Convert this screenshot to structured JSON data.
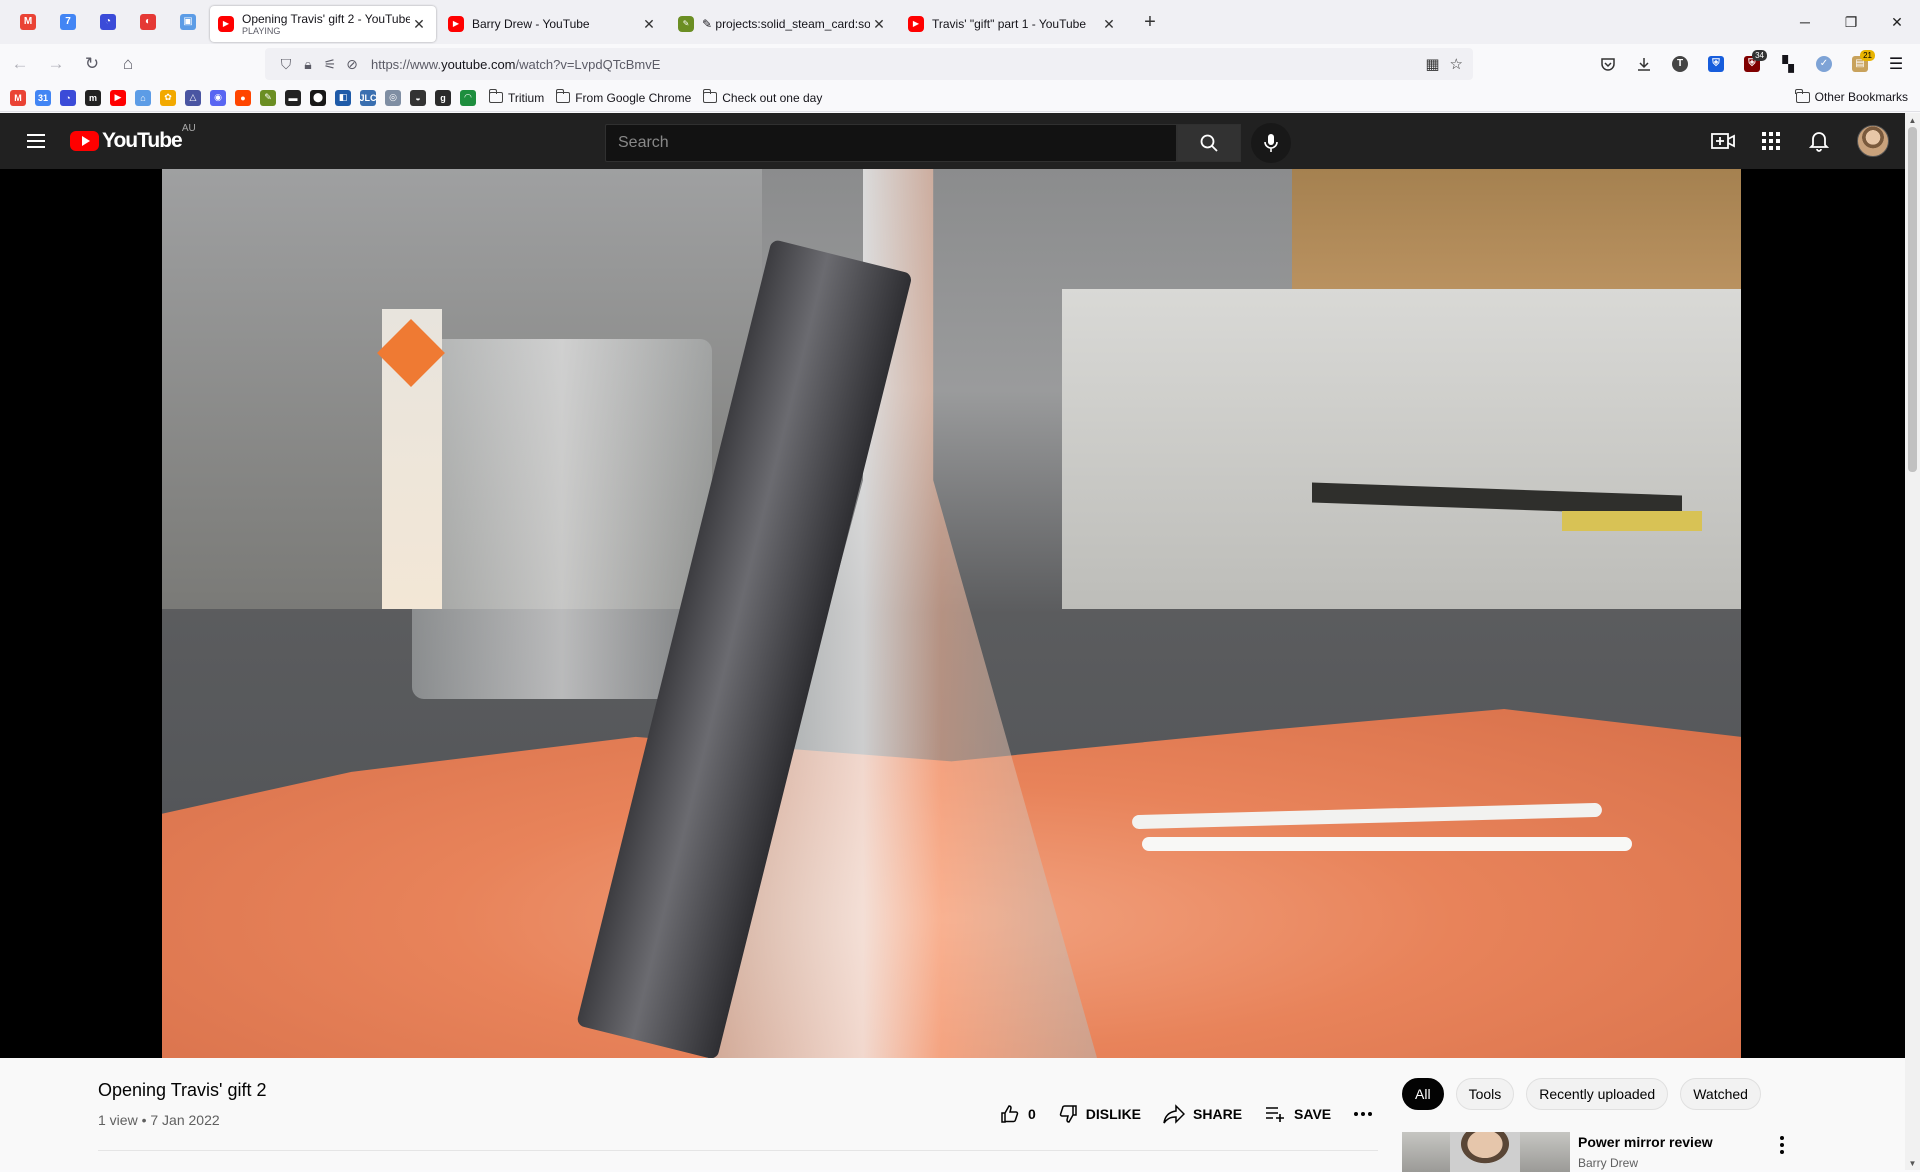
{
  "browser": {
    "pinned": [
      {
        "name": "gmail",
        "glyph": "M",
        "color": "#ea4335"
      },
      {
        "name": "calendar",
        "glyph": "7",
        "color": "#4285f4"
      },
      {
        "name": "app-blue",
        "glyph": "◔",
        "color": "#3b4bd8"
      },
      {
        "name": "app-red",
        "glyph": "◐",
        "color": "#e53935"
      },
      {
        "name": "app-cube",
        "glyph": "▣",
        "color": "#5c9ce6"
      }
    ],
    "tabs": [
      {
        "title": "Opening Travis' gift 2 - YouTube",
        "subtitle": "PLAYING",
        "active": true
      },
      {
        "title": "Barry Drew - YouTube",
        "subtitle": "",
        "active": false
      },
      {
        "title": "✎ projects:solid_steam_card:so",
        "subtitle": "",
        "active": false
      },
      {
        "title": "Travis' \"gift\" part 1 - YouTube",
        "subtitle": "",
        "active": false
      }
    ],
    "url_prefix": "https://www.",
    "url_domain": "youtube.com",
    "url_path": "/watch?v=LvpdQTcBmvE",
    "extension_badges": {
      "ublock": "34",
      "other": "21"
    },
    "bookmark_folders": [
      "Tritium",
      "From Google Chrome",
      "Check out one day"
    ],
    "other_bookmarks": "Other Bookmarks",
    "bookmark_icons": [
      {
        "glyph": "M",
        "color": "#ea4335"
      },
      {
        "glyph": "31",
        "color": "#4285f4"
      },
      {
        "glyph": "◔",
        "color": "#3b4bd8"
      },
      {
        "glyph": "m",
        "color": "#222222"
      },
      {
        "glyph": "▶",
        "color": "#ff0000"
      },
      {
        "glyph": "⌂",
        "color": "#5c9ce6"
      },
      {
        "glyph": "✿",
        "color": "#f2a900"
      },
      {
        "glyph": "△",
        "color": "#4a55a2"
      },
      {
        "glyph": "◉",
        "color": "#5865f2"
      },
      {
        "glyph": "●",
        "color": "#ff4500"
      },
      {
        "glyph": "✎",
        "color": "#6b8e23"
      },
      {
        "glyph": "▬",
        "color": "#222222"
      },
      {
        "glyph": "⬤",
        "color": "#181717"
      },
      {
        "glyph": "◧",
        "color": "#1e5aa8"
      },
      {
        "glyph": "JLC",
        "color": "#3a6fb0"
      },
      {
        "glyph": "◎",
        "color": "#7f8ea3"
      },
      {
        "glyph": "◒",
        "color": "#333333"
      },
      {
        "glyph": "g",
        "color": "#2b2b2b"
      },
      {
        "glyph": "◠",
        "color": "#1e8e3e"
      }
    ]
  },
  "youtube": {
    "logo_text": "YouTube",
    "country_code": "AU",
    "search_placeholder": "Search",
    "video": {
      "title": "Opening Travis' gift 2",
      "meta": "1 view • 7 Jan 2022",
      "likes": "0",
      "dislike_label": "DISLIKE",
      "share_label": "SHARE",
      "save_label": "SAVE"
    },
    "chips": [
      "All",
      "Tools",
      "Recently uploaded",
      "Watched"
    ],
    "recommendation": {
      "title": "Power mirror review",
      "channel": "Barry Drew"
    }
  }
}
